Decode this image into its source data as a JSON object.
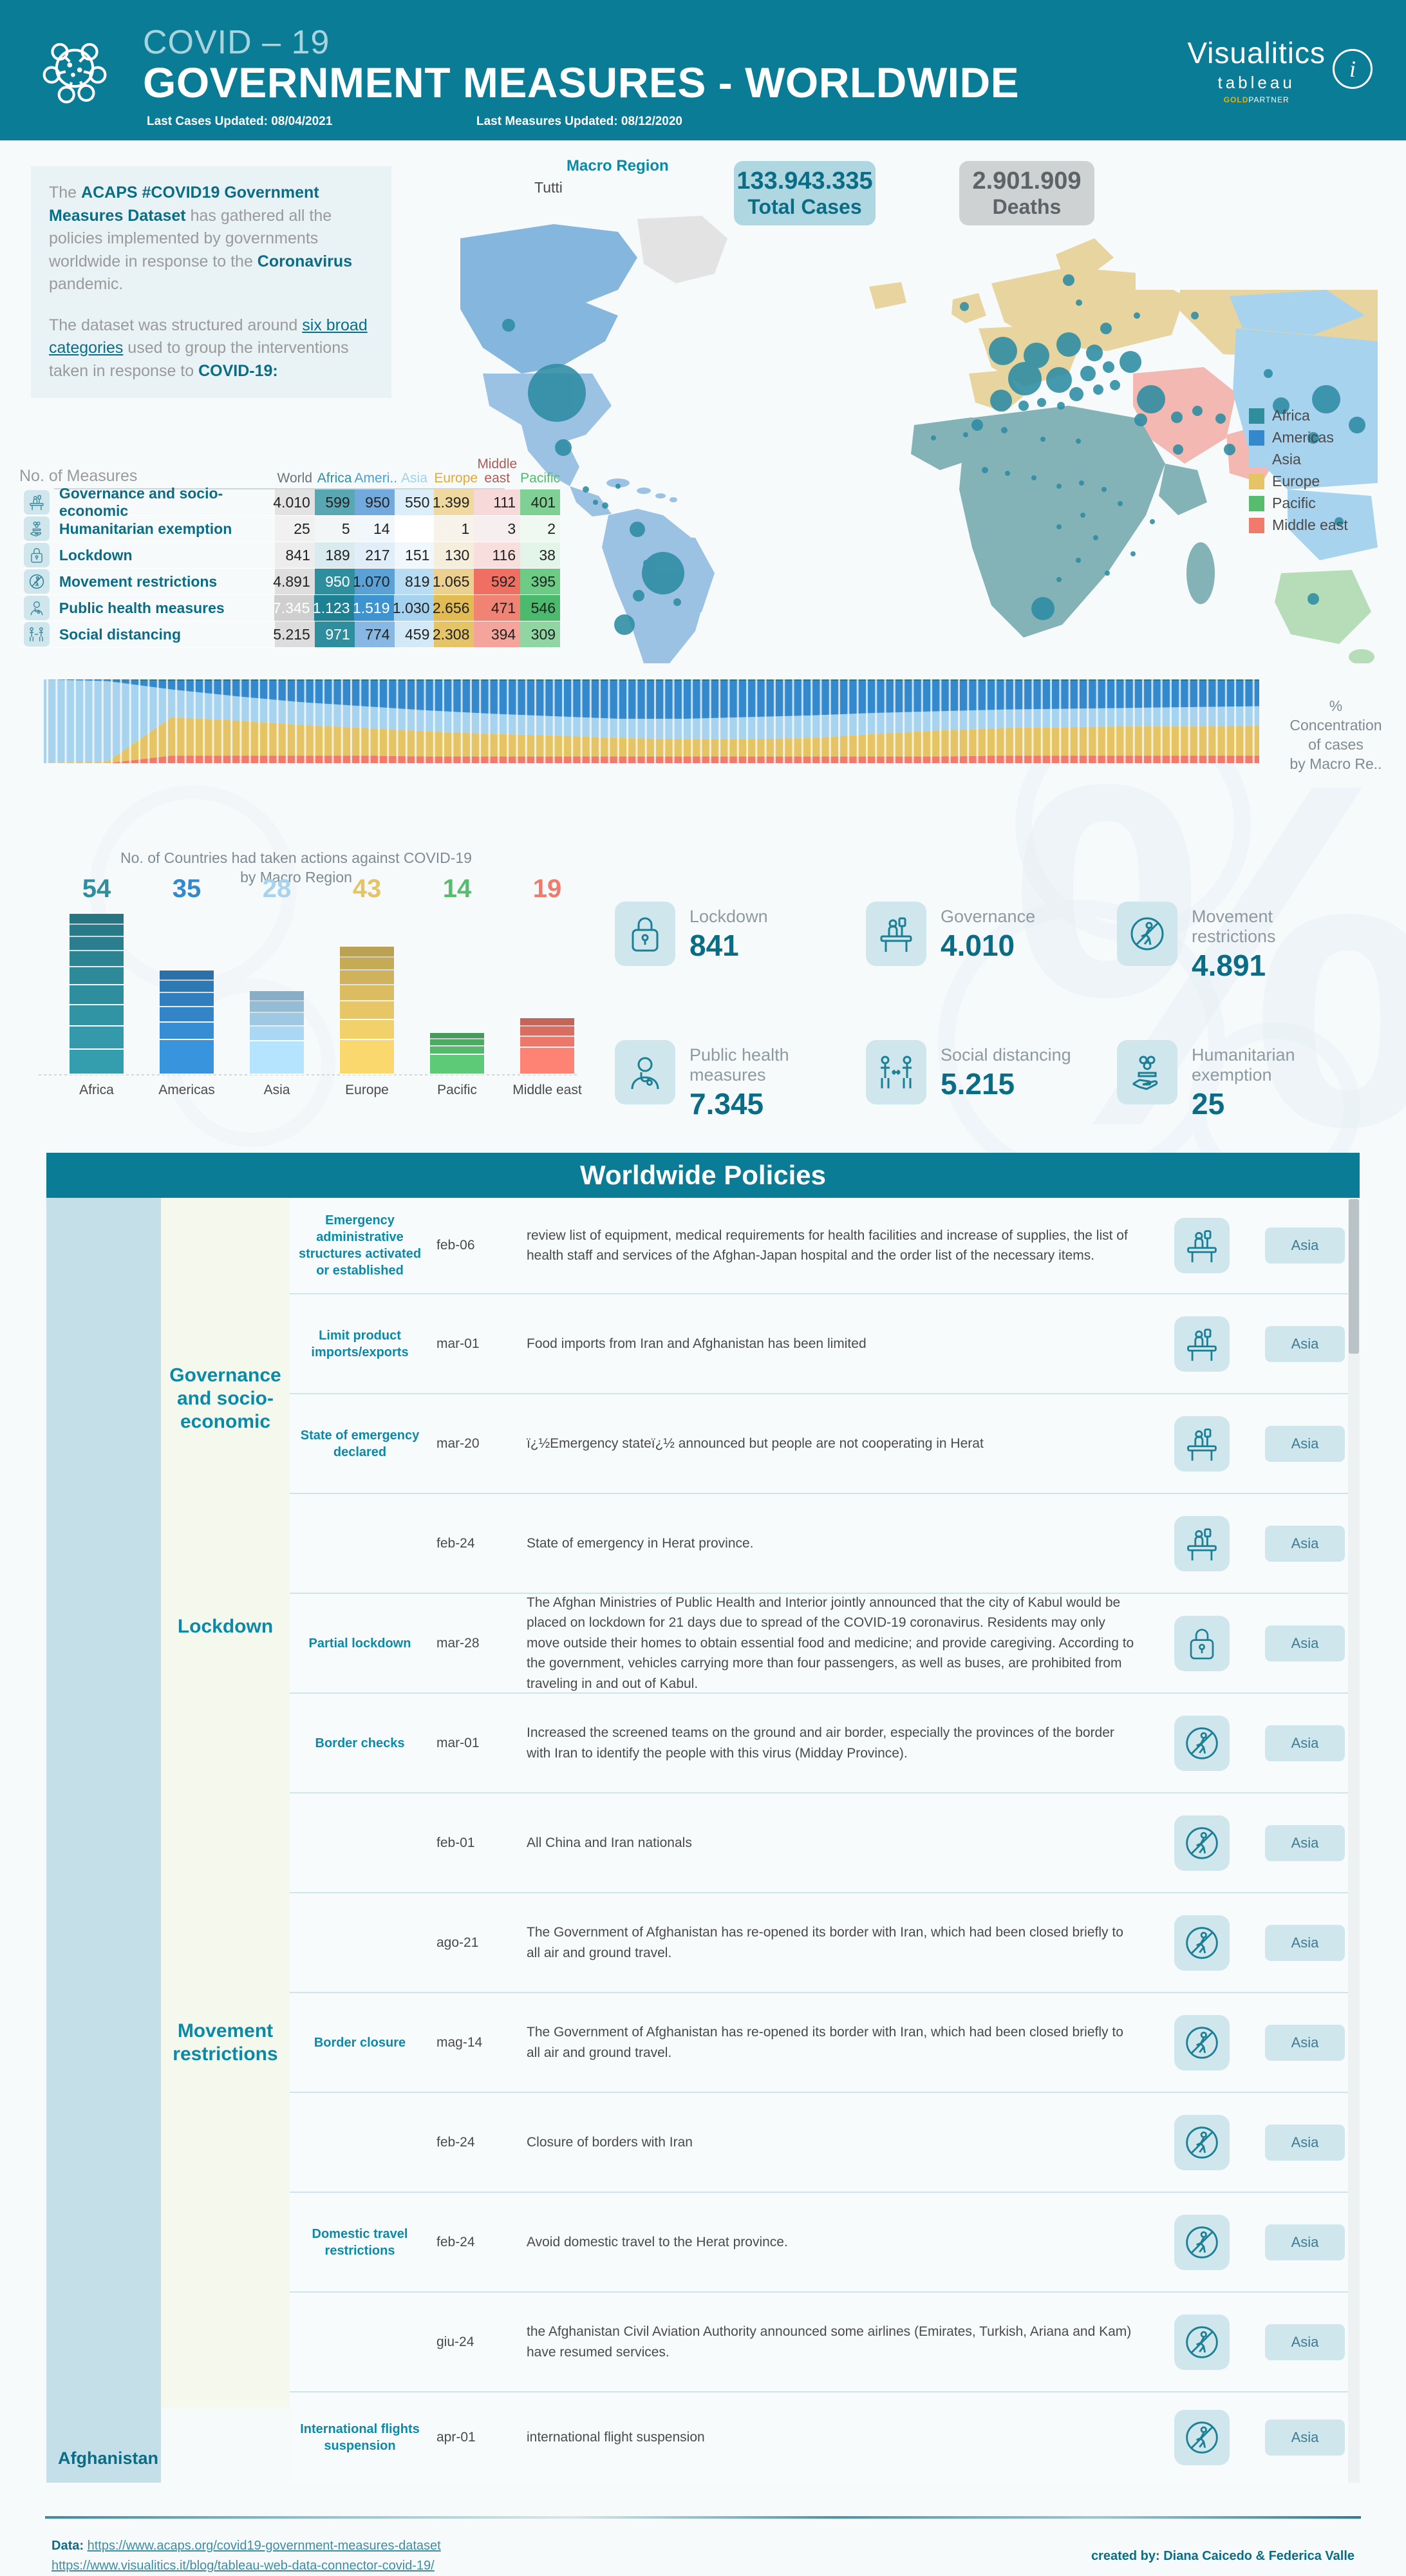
{
  "header": {
    "pretitle": "COVID – 19",
    "title": "GOVERNMENT MEASURES - WORLDWIDE",
    "last_cases_updated": "Last Cases Updated: 08/04/2021",
    "last_measures_updated": "Last Measures Updated: 08/12/2020",
    "brand_name": "Visualitics",
    "brand_partner": "tableau",
    "brand_gold": "GOLD",
    "brand_partner_label": "PARTNER",
    "info_glyph": "i",
    "bg_color": "#0b7c96"
  },
  "intro": {
    "p1_a": "The ",
    "p1_b": "ACAPS #COVID19 Government Measures Dataset",
    "p1_c": " has gathered all the policies implemented by governments worldwide in response to the ",
    "p1_d": "Coronavirus",
    "p1_e": " pandemic.",
    "p2_a": "The dataset was structured around ",
    "p2_link": "six broad categories",
    "p2_b": " used to group the interventions taken in response to ",
    "p2_c": "COVID-19:"
  },
  "measures_table": {
    "title": "No. of Measures",
    "columns": [
      "World",
      "Africa",
      "Ameri..",
      "Asia",
      "Europe",
      "Middle east",
      "Pacific"
    ],
    "column_colors": [
      "#6b7478",
      "#2f8e9e",
      "#4a9ed6",
      "#9fd0ee",
      "#e0a93a",
      "#b05a55",
      "#4fbb6b"
    ],
    "rows": [
      {
        "icon": "governance-icon",
        "label": "Governance and socio-economic",
        "values": [
          "4.010",
          "599",
          "950",
          "550",
          "1.399",
          "111",
          "401"
        ],
        "cell_bg": [
          "#e2e2e2",
          "#5aa7b4",
          "#73aade",
          "#dceefa",
          "#efd9a0",
          "#f6d9d8",
          "#7fd094"
        ],
        "cell_fg": [
          "#222",
          "#222",
          "#222",
          "#222",
          "#222",
          "#222",
          "#222"
        ]
      },
      {
        "icon": "humanitarian-icon",
        "label": "Humanitarian exemption",
        "values": [
          "25",
          "5",
          "14",
          "",
          "1",
          "3",
          "2"
        ],
        "cell_bg": [
          "#f1f1f1",
          "#f2f6f7",
          "#f2f7fb",
          "#ffffff",
          "#f7f3ea",
          "#f7efef",
          "#f0f8f2"
        ],
        "cell_fg": [
          "#222",
          "#222",
          "#222",
          "#222",
          "#222",
          "#222",
          "#222"
        ]
      },
      {
        "icon": "lockdown-icon",
        "label": "Lockdown",
        "values": [
          "841",
          "189",
          "217",
          "151",
          "130",
          "116",
          "38"
        ],
        "cell_bg": [
          "#ededed",
          "#d9ebee",
          "#e1eef9",
          "#f0f7fd",
          "#f6eedd",
          "#f8dedd",
          "#e3f5e8"
        ],
        "cell_fg": [
          "#222",
          "#222",
          "#222",
          "#222",
          "#222",
          "#222",
          "#222"
        ]
      },
      {
        "icon": "movement-icon",
        "label": "Movement restrictions",
        "values": [
          "4.891",
          "950",
          "1.070",
          "819",
          "1.065",
          "592",
          "395"
        ],
        "cell_bg": [
          "#dedede",
          "#2f8e9e",
          "#5aa1d8",
          "#b7dcf3",
          "#ecd092",
          "#ef6f62",
          "#6ccb84"
        ],
        "cell_fg": [
          "#222",
          "#ffffff",
          "#222",
          "#222",
          "#222",
          "#222",
          "#222"
        ]
      },
      {
        "icon": "publichealth-icon",
        "label": "Public health measures",
        "values": [
          "7.345",
          "1.123",
          "1.519",
          "1.030",
          "2.656",
          "471",
          "546"
        ],
        "cell_bg": [
          "#cfcfcf",
          "#1d8193",
          "#3e93d1",
          "#a5d3ef",
          "#e3bb53",
          "#f08374",
          "#4cba6d"
        ],
        "cell_fg": [
          "#ffffff",
          "#ffffff",
          "#ffffff",
          "#222",
          "#222",
          "#222",
          "#222"
        ]
      },
      {
        "icon": "socialdistancing-icon",
        "label": "Social distancing",
        "values": [
          "5.215",
          "971",
          "774",
          "459",
          "2.308",
          "394",
          "309"
        ],
        "cell_bg": [
          "#dcdcdc",
          "#2f8e9e",
          "#86b8e3",
          "#d3e9f8",
          "#e5c468",
          "#f4a49a",
          "#90d6a3"
        ],
        "cell_fg": [
          "#222",
          "#ffffff",
          "#222",
          "#222",
          "#222",
          "#222",
          "#222"
        ]
      }
    ]
  },
  "map": {
    "macro_region_label": "Macro Region",
    "macro_region_value": "Tutti",
    "total_cases": "133.943.335",
    "total_cases_label": "Total Cases",
    "deaths": "2.901.909",
    "deaths_label": "Deaths",
    "legend": [
      {
        "label": "Africa",
        "color": "#2f8e9e"
      },
      {
        "label": "Americas",
        "color": "#3488cc"
      },
      {
        "label": "Asia",
        "color": "#a7d3ef"
      },
      {
        "label": "Europe",
        "color": "#e4c464"
      },
      {
        "label": "Pacific",
        "color": "#56bd6e"
      },
      {
        "label": "Middle east",
        "color": "#f07a6c"
      }
    ]
  },
  "area_chart": {
    "caption_lines": [
      "%",
      "Concentration",
      "of cases",
      "by Macro Re.."
    ]
  },
  "chart_data": [
    {
      "type": "bar",
      "title": "No. of Countries had taken actions against COVID-19 by Macro Region",
      "categories": [
        "Africa",
        "Americas",
        "Asia",
        "Europe",
        "Pacific",
        "Middle east"
      ],
      "values": [
        54,
        35,
        28,
        43,
        14,
        19
      ],
      "value_colors": [
        "#2f8e9e",
        "#3488cc",
        "#a7d3ef",
        "#e4c464",
        "#56bd6e",
        "#f07a6c"
      ],
      "xlabel": "",
      "ylabel": "",
      "ylim": [
        0,
        60
      ],
      "grid": false,
      "legend": "none"
    },
    {
      "type": "area",
      "title": "% Concentration of cases by Macro Re..",
      "stacked": true,
      "normalized": true,
      "series": [
        {
          "name": "Middle east",
          "color": "#f07a6c",
          "values": [
            0,
            0,
            9,
            9,
            9,
            9,
            8,
            8,
            8,
            8,
            8,
            8,
            8,
            8,
            8,
            9,
            9,
            9,
            9,
            9
          ]
        },
        {
          "name": "Europe",
          "color": "#e4c464",
          "values": [
            0,
            2,
            46,
            42,
            37,
            33,
            30,
            27,
            25,
            22,
            21,
            21,
            22,
            27,
            31,
            33,
            34,
            35,
            35,
            36
          ]
        },
        {
          "name": "Asia",
          "color": "#a7d3ef",
          "values": [
            100,
            96,
            33,
            29,
            27,
            26,
            25,
            24,
            23,
            23,
            24,
            26,
            27,
            25,
            23,
            22,
            22,
            22,
            23,
            23
          ]
        },
        {
          "name": "Americas",
          "color": "#3488cc",
          "values": [
            0,
            1,
            10,
            18,
            25,
            30,
            35,
            39,
            42,
            45,
            45,
            43,
            41,
            38,
            36,
            34,
            33,
            32,
            31,
            30
          ]
        },
        {
          "name": "Africa",
          "color": "#1f7a88",
          "values": [
            0,
            1,
            2,
            2,
            2,
            2,
            2,
            2,
            2,
            2,
            2,
            2,
            2,
            2,
            2,
            2,
            2,
            2,
            2,
            2
          ]
        }
      ],
      "xlabel": "",
      "ylabel": "",
      "grid": false,
      "legend": "none"
    }
  ],
  "kpi_cards": [
    {
      "icon": "lockdown-icon",
      "label": "Lockdown",
      "value": "841"
    },
    {
      "icon": "governance-icon",
      "label": "Governance",
      "value": "4.010"
    },
    {
      "icon": "movement-icon",
      "label": "Movement restrictions",
      "value": "4.891"
    },
    {
      "icon": "publichealth-icon",
      "label": "Public health measures",
      "value": "7.345"
    },
    {
      "icon": "socialdistancing-icon",
      "label": "Social distancing",
      "value": "5.215"
    },
    {
      "icon": "humanitarian-icon",
      "label": "Humanitarian exemption",
      "value": "25"
    }
  ],
  "policies": {
    "title": "Worldwide Policies",
    "country": "Afghanistan",
    "categories": [
      {
        "label": "Governance and socio-economic",
        "rows": 4
      },
      {
        "label": "Lockdown",
        "rows": 1
      },
      {
        "label": "Movement restrictions",
        "rows": 7
      }
    ],
    "rows": [
      {
        "measure": "Emergency administrative structures activated or established",
        "date": "feb-06",
        "desc": "review list of equipment, medical requirements for health facilities and increase of supplies, the list of health staff and services of the Afghan-Japan hospital and the order list of the necessary items.",
        "icon": "governance-icon",
        "region": "Asia",
        "h": 150
      },
      {
        "measure": "Limit product imports/exports",
        "date": "mar-01",
        "desc": "Food imports from Iran and Afghanistan has been limited",
        "icon": "governance-icon",
        "region": "Asia",
        "h": 155
      },
      {
        "measure": "State of emergency declared",
        "date": "mar-20",
        "desc": "ï¿½Emergency stateï¿½ announced but people are not cooperating in Herat",
        "icon": "governance-icon",
        "region": "Asia",
        "h": 155
      },
      {
        "measure": "",
        "date": "feb-24",
        "desc": "State of emergency in Herat province.",
        "icon": "governance-icon",
        "region": "Asia",
        "h": 155
      },
      {
        "measure": "Partial lockdown",
        "date": "mar-28",
        "desc": "The Afghan Ministries of Public Health and Interior jointly announced that the city of Kabul would be placed on lockdown for 21 days due to spread of the COVID-19 coronavirus. Residents may only move outside their homes to obtain essential food and medicine; and provide caregiving. According to the government, vehicles carrying more than four passengers, as well as buses, are prohibited from traveling in and out of Kabul.",
        "icon": "lockdown-icon",
        "region": "Asia",
        "h": 155
      },
      {
        "measure": "Border checks",
        "date": "mar-01",
        "desc": "Increased the screened teams on the ground and air border, especially the provinces of the border with Iran to identify the people with this virus (Midday Province).",
        "icon": "movement-icon",
        "region": "Asia",
        "h": 155
      },
      {
        "measure": "",
        "date": "feb-01",
        "desc": "All China and Iran nationals",
        "icon": "movement-icon",
        "region": "Asia",
        "h": 155
      },
      {
        "measure": "",
        "date": "ago-21",
        "desc": "The Government of Afghanistan has re-opened its border with Iran, which had been closed briefly to all air and ground travel.",
        "icon": "movement-icon",
        "region": "Asia",
        "h": 155
      },
      {
        "measure": "Border closure",
        "date": "mag-14",
        "desc": "The Government of Afghanistan has re-opened its border with Iran, which had been closed briefly to all air and ground travel.",
        "icon": "movement-icon",
        "region": "Asia",
        "h": 155
      },
      {
        "measure": "",
        "date": "feb-24",
        "desc": "Closure of borders with Iran",
        "icon": "movement-icon",
        "region": "Asia",
        "h": 155
      },
      {
        "measure": "Domestic travel restrictions",
        "date": "feb-24",
        "desc": "Avoid domestic travel to the Herat province.",
        "icon": "movement-icon",
        "region": "Asia",
        "h": 155
      },
      {
        "measure": "",
        "date": "giu-24",
        "desc": "the Afghanistan Civil Aviation Authority announced some airlines (Emirates, Turkish, Ariana and Kam) have resumed services.",
        "icon": "movement-icon",
        "region": "Asia",
        "h": 155
      },
      {
        "measure": "International flights suspension",
        "date": "apr-01",
        "desc": "international flight suspension",
        "icon": "movement-icon",
        "region": "Asia",
        "h": 140
      }
    ]
  },
  "footer": {
    "data_label": "Data:",
    "link1": "https://www.acaps.org/covid19-government-measures-dataset",
    "link2": "https://www.visualitics.it/blog/tableau-web-data-connector-covid-19/",
    "credit": "created by: Diana Caicedo & Federica Valle"
  }
}
